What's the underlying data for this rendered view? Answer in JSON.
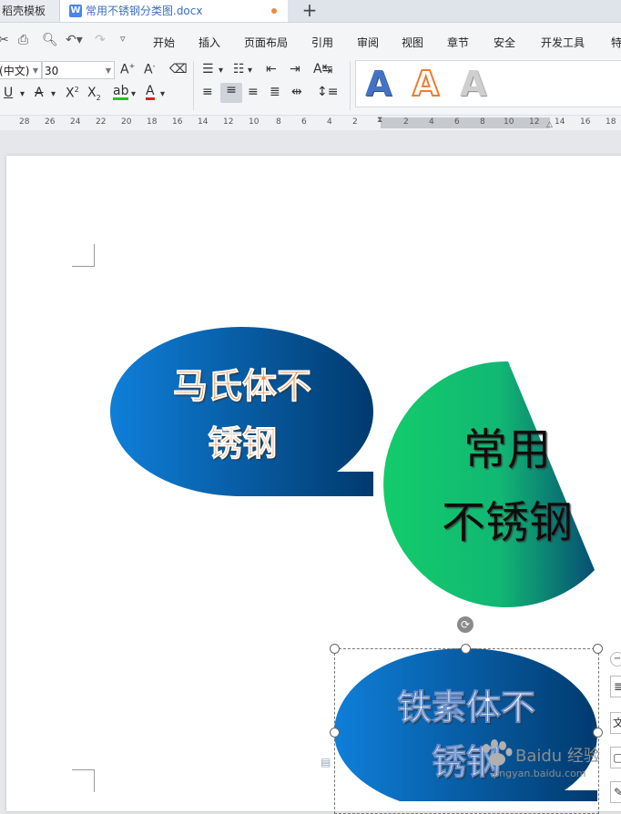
{
  "tabs": {
    "prev_label": "稻壳模板",
    "active_label": "常用不锈钢分类图.docx",
    "new_tab": "+"
  },
  "menu": {
    "items": [
      "开始",
      "插入",
      "页面布局",
      "引用",
      "审阅",
      "视图",
      "章节",
      "安全",
      "开发工具",
      "特"
    ]
  },
  "toolbar": {
    "font_name": "(中文)",
    "font_size": "30",
    "wordart_samples": [
      "A",
      "A",
      "A"
    ]
  },
  "ruler": {
    "ticks": [
      "28",
      "26",
      "24",
      "22",
      "20",
      "18",
      "16",
      "14",
      "12",
      "10",
      "8",
      "6",
      "4",
      "2",
      "2",
      "4",
      "6",
      "8",
      "10",
      "12",
      "14",
      "16",
      "18"
    ]
  },
  "shapes": {
    "martensitic": {
      "line1": "马氏体不",
      "line2": "锈钢"
    },
    "common": {
      "line1": "常用",
      "line2": "不锈钢"
    },
    "ferritic": {
      "line1": "铁素体不",
      "line2": "锈钢"
    }
  },
  "watermark": {
    "main": "Baidu 经验",
    "sub": "jingyan.baidu.com"
  },
  "colors": {
    "blue_start": "#0f7fd9",
    "blue_end": "#003a6e",
    "green_start": "#11cf6e",
    "green_end": "#064e73",
    "orange_text": "#f08a3c",
    "active_tab_text": "#3a6fc0"
  }
}
